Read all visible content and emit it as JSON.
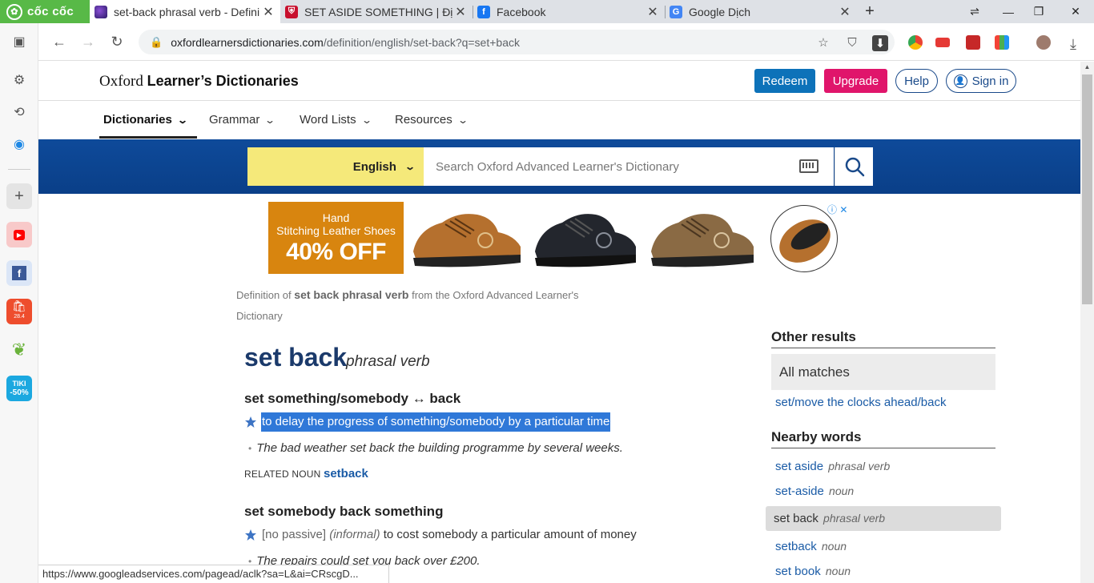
{
  "browser": {
    "brand": "cốc cốc",
    "tabs": [
      {
        "title": "set-back phrasal verb - Defini",
        "icon": "oxford-icon",
        "active": true
      },
      {
        "title": "SET ASIDE SOMETHING | Định",
        "icon": "cambridge-icon",
        "active": false
      },
      {
        "title": "Facebook",
        "icon": "facebook-icon",
        "active": false
      },
      {
        "title": "Google Dịch",
        "icon": "google-translate-icon",
        "active": false
      }
    ],
    "url_domain": "oxfordlearnersdictionaries.com",
    "url_path": "/definition/english/set-back?q=set+back",
    "status_url": "https://www.googleadservices.com/pagead/aclk?sa=L&ai=CRscgD..."
  },
  "sidebar": {
    "items": [
      "wallet-icon",
      "gear-icon",
      "history-icon",
      "messenger-icon",
      "add-icon",
      "youtube-icon",
      "facebook-icon",
      "shopee-icon",
      "leaf-icon",
      "tiki-icon"
    ],
    "shopee_badge": "28.4",
    "tiki_label": "TIKI",
    "tiki_badge": "-50%"
  },
  "site": {
    "logo_plain": "Oxford",
    "logo_bold": "Learner’s Dictionaries",
    "redeem": "Redeem",
    "upgrade": "Upgrade",
    "help": "Help",
    "signin": "Sign in",
    "nav": [
      "Dictionaries",
      "Grammar",
      "Word Lists",
      "Resources"
    ],
    "search": {
      "language": "English",
      "placeholder": "Search Oxford Advanced Learner's Dictionary"
    }
  },
  "ad": {
    "line1": "Hand",
    "line2": "Stitching Leather Shoes",
    "line3": "40% OFF"
  },
  "entry": {
    "source_prefix": "Definition of",
    "source_term": "set back phrasal verb",
    "source_suffix": "from the Oxford Advanced Learner's Dictionary",
    "headword": "set back",
    "pos": "phrasal verb",
    "sense1": {
      "head": "set something/somebody ↔ back",
      "definition": "to delay the progress of something/somebody by a particular time",
      "example": "The bad weather set back the building programme by several weeks.",
      "related_label": "RELATED NOUN",
      "related_link": "setback"
    },
    "sense2": {
      "head": "set somebody back something",
      "grammar": "[no passive]",
      "register": "(informal)",
      "definition": "to cost somebody a particular amount of money",
      "example": "The repairs could set you back over £200."
    }
  },
  "right": {
    "other_results": "Other results",
    "all_matches": "All matches",
    "other_links": [
      {
        "text": "set/move the clocks ahead/back"
      }
    ],
    "nearby_words": "Nearby words",
    "nearby": [
      {
        "word": "set aside",
        "pos": "phrasal verb"
      },
      {
        "word": "set-aside",
        "pos": "noun"
      },
      {
        "word": "set back",
        "pos": "phrasal verb"
      },
      {
        "word": "setback",
        "pos": "noun"
      },
      {
        "word": "set book",
        "pos": "noun"
      }
    ]
  },
  "colors": {
    "redeem": "#0d72b9",
    "upgrade": "#e0156b",
    "search_band": "#0e4a9a",
    "lang_select": "#f5e97a",
    "headword": "#1b3a6b",
    "link": "#1a5ba6",
    "highlight": "#2f78d8"
  }
}
